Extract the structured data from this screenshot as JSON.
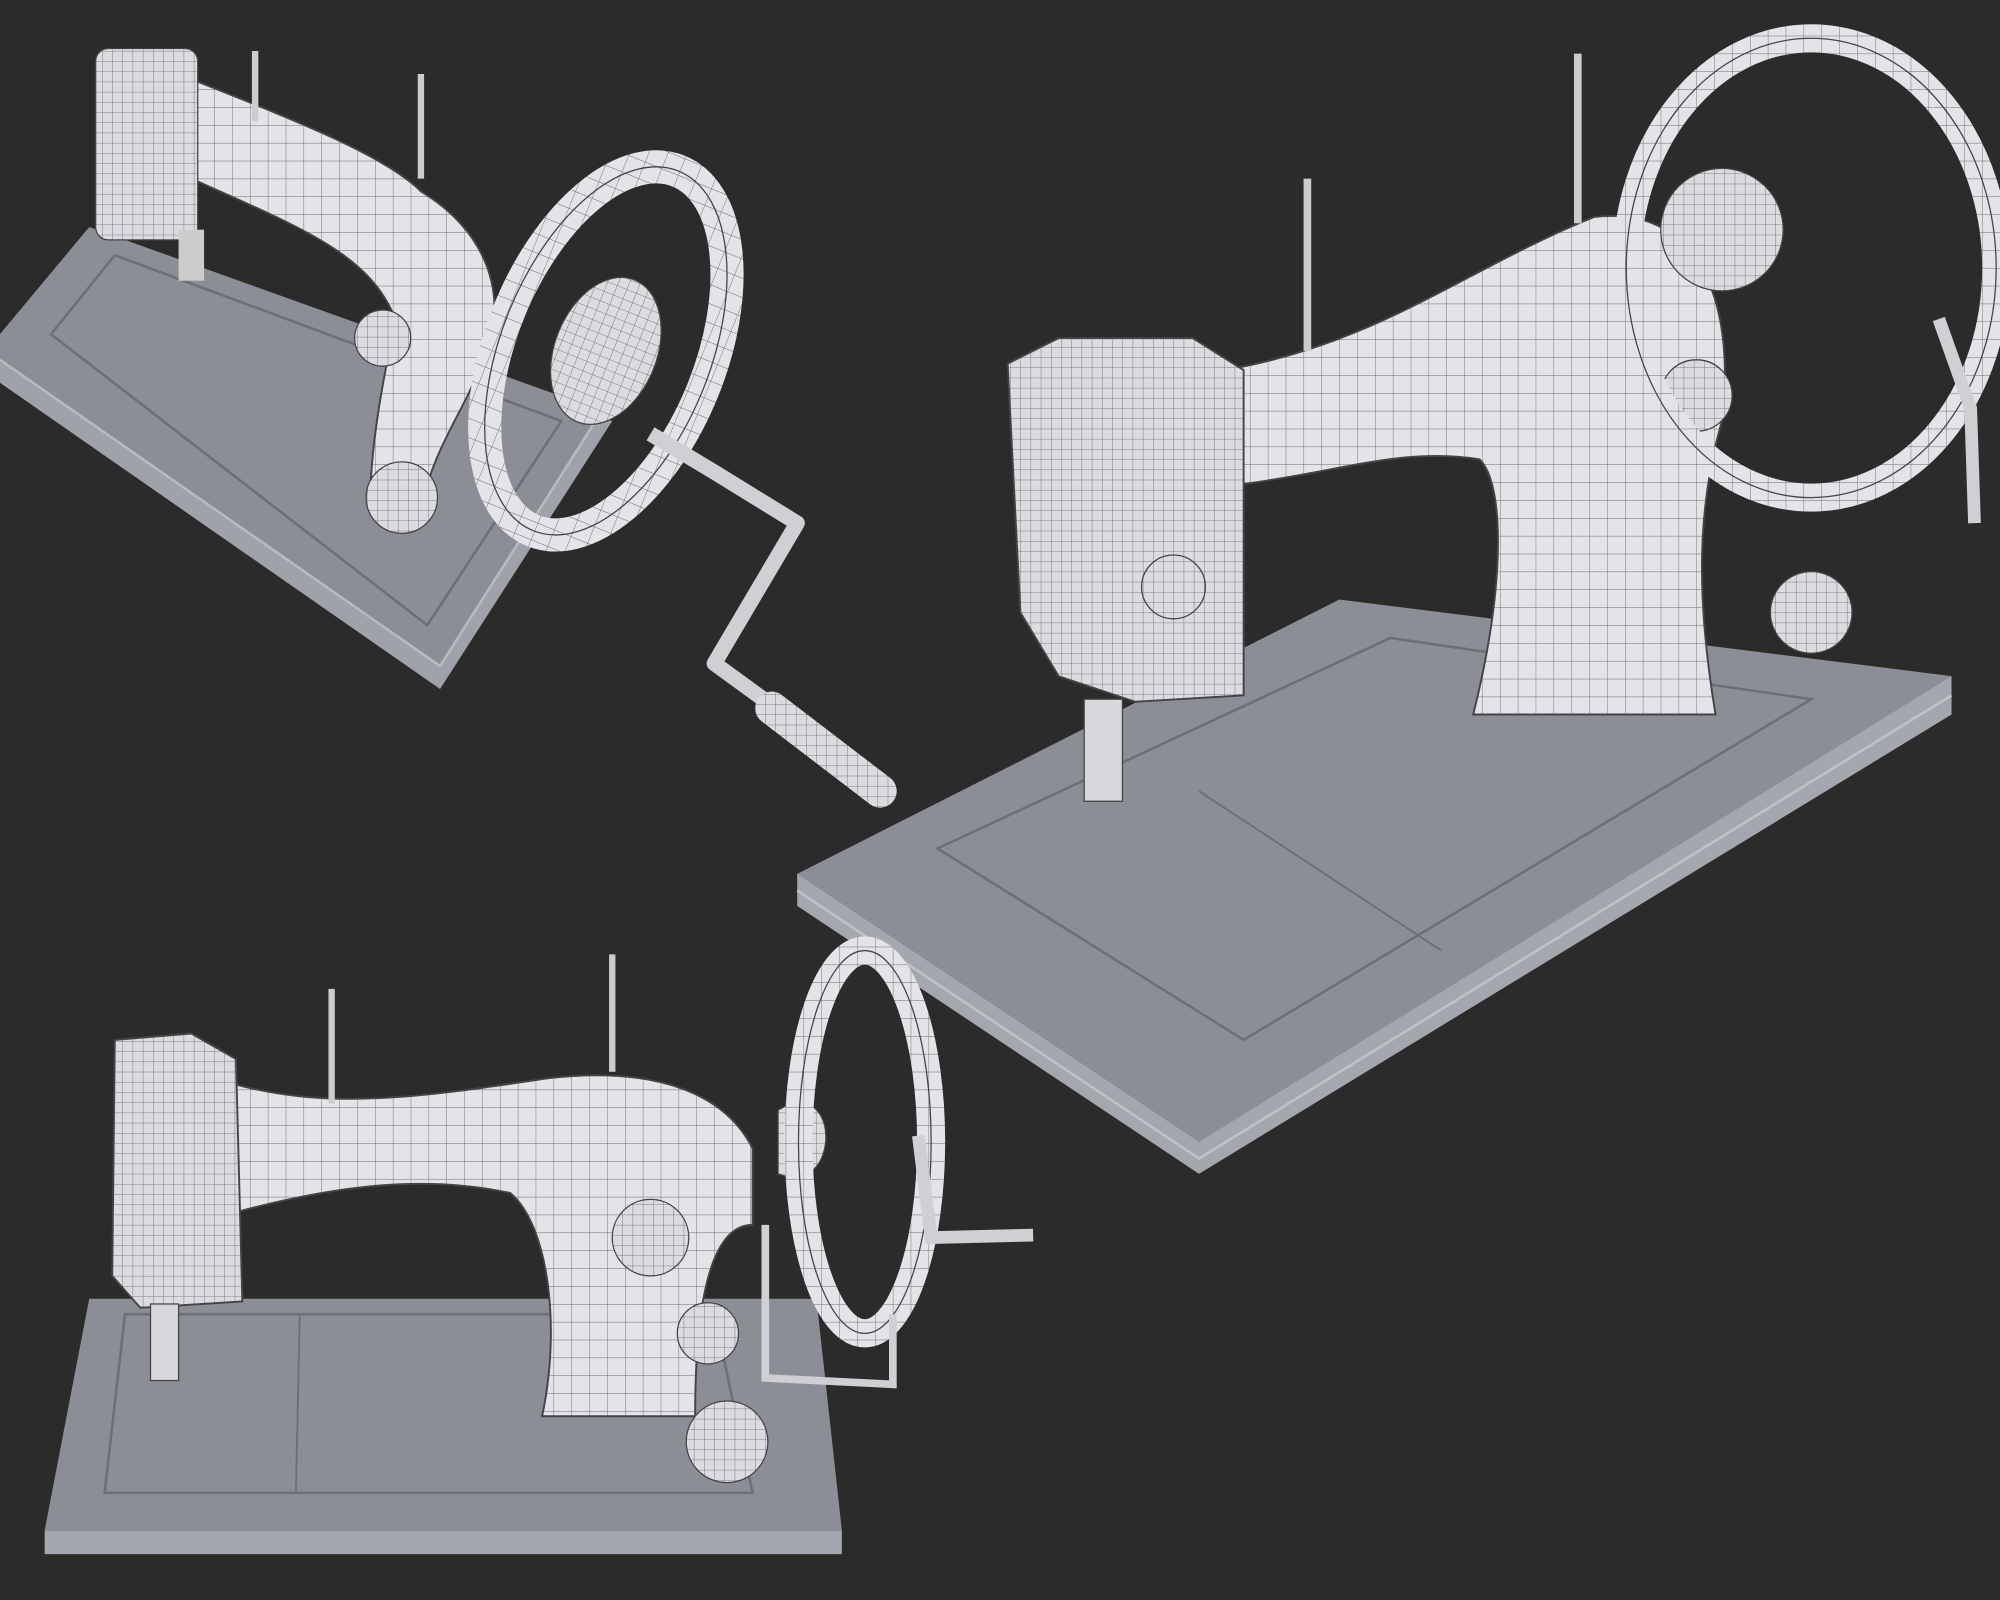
{
  "colors": {
    "background": "#2b2b2b",
    "base_plate": "#8c8e96",
    "base_edge": "#a9abb2",
    "body": "#e4e3e8",
    "wire": "#5a5a60"
  }
}
